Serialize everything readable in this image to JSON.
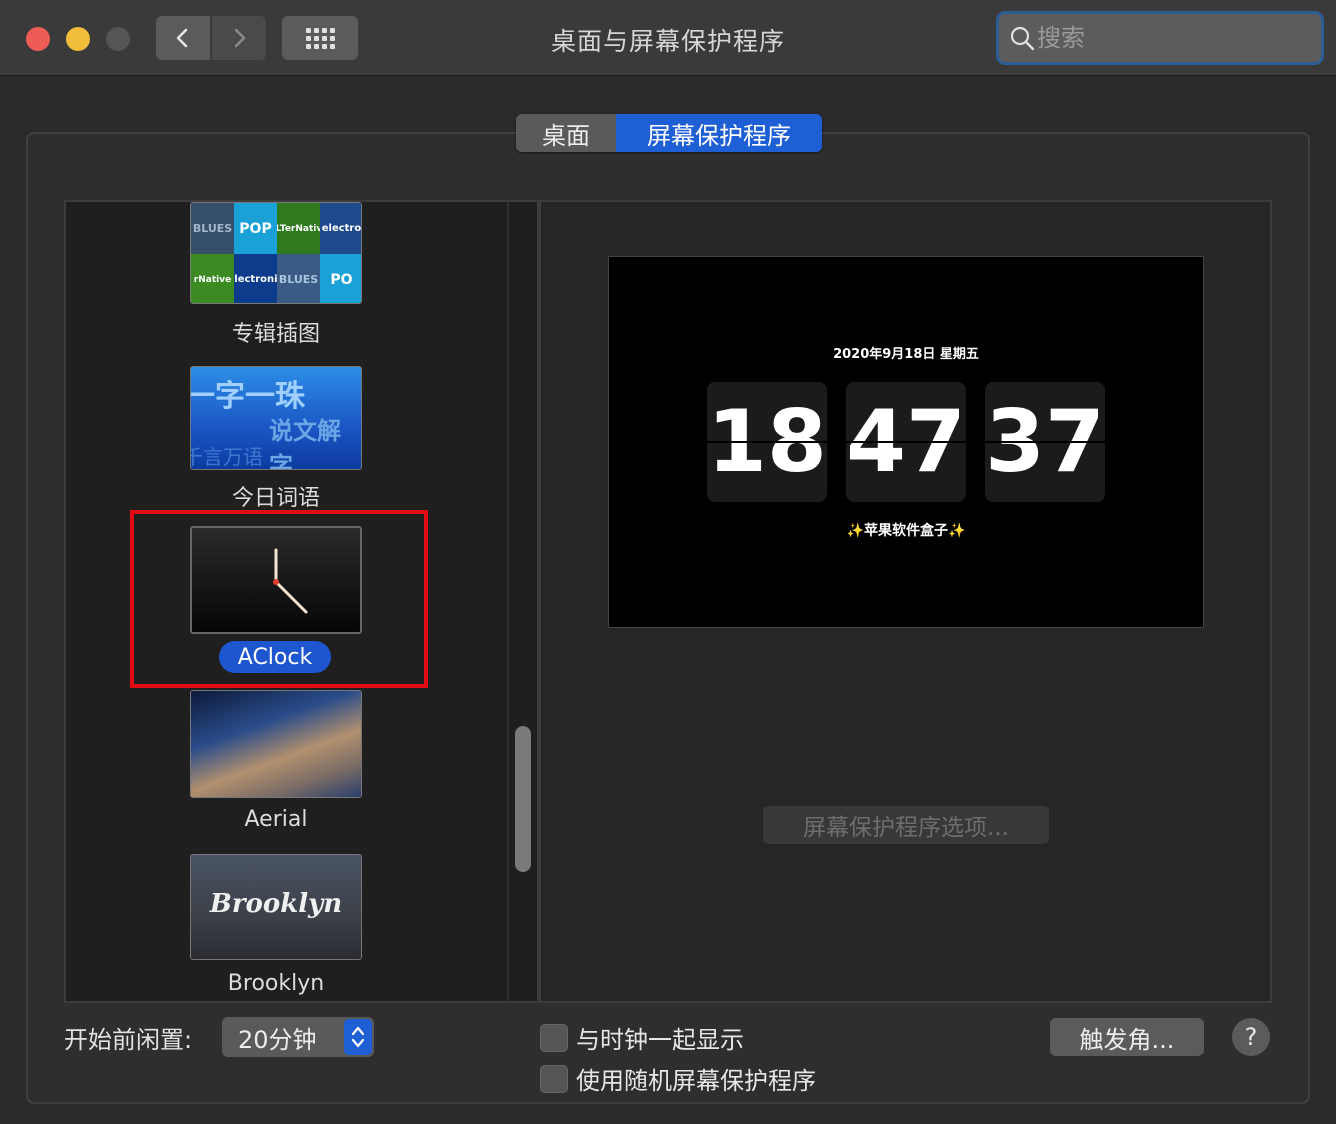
{
  "window": {
    "title": "桌面与屏幕保护程序",
    "search_placeholder": "搜索"
  },
  "tabs": [
    {
      "label": "桌面",
      "selected": false
    },
    {
      "label": "屏幕保护程序",
      "selected": true
    }
  ],
  "savers": [
    {
      "label": "专辑插图",
      "selected": false
    },
    {
      "label": "今日词语",
      "selected": false
    },
    {
      "label": "AClock",
      "selected": true
    },
    {
      "label": "Aerial",
      "selected": false
    },
    {
      "label": "Brooklyn",
      "selected": false
    }
  ],
  "thumb_text": {
    "album": [
      "BLUES",
      "POP",
      "ALTerNative",
      "electro",
      "rNative",
      "electronic",
      "BLUES",
      "PO"
    ],
    "word": [
      "一字一珠",
      "说文解字",
      "千言万语"
    ],
    "brooklyn": "Brooklyn"
  },
  "preview": {
    "date": "2020年9月18日 星期五",
    "hour": "18",
    "minute": "47",
    "second": "37",
    "brand": "苹果软件盒子",
    "sparkle": "✨"
  },
  "options_button": "屏幕保护程序选项...",
  "idle": {
    "label": "开始前闲置:",
    "value": "20分钟"
  },
  "checkboxes": [
    {
      "label": "与时钟一起显示",
      "checked": false
    },
    {
      "label": "使用随机屏幕保护程序",
      "checked": false
    }
  ],
  "trigger_button": "触发角...",
  "help": "?",
  "colors": {
    "accent": "#1f5fd6",
    "selection_frame": "#e00c12"
  }
}
